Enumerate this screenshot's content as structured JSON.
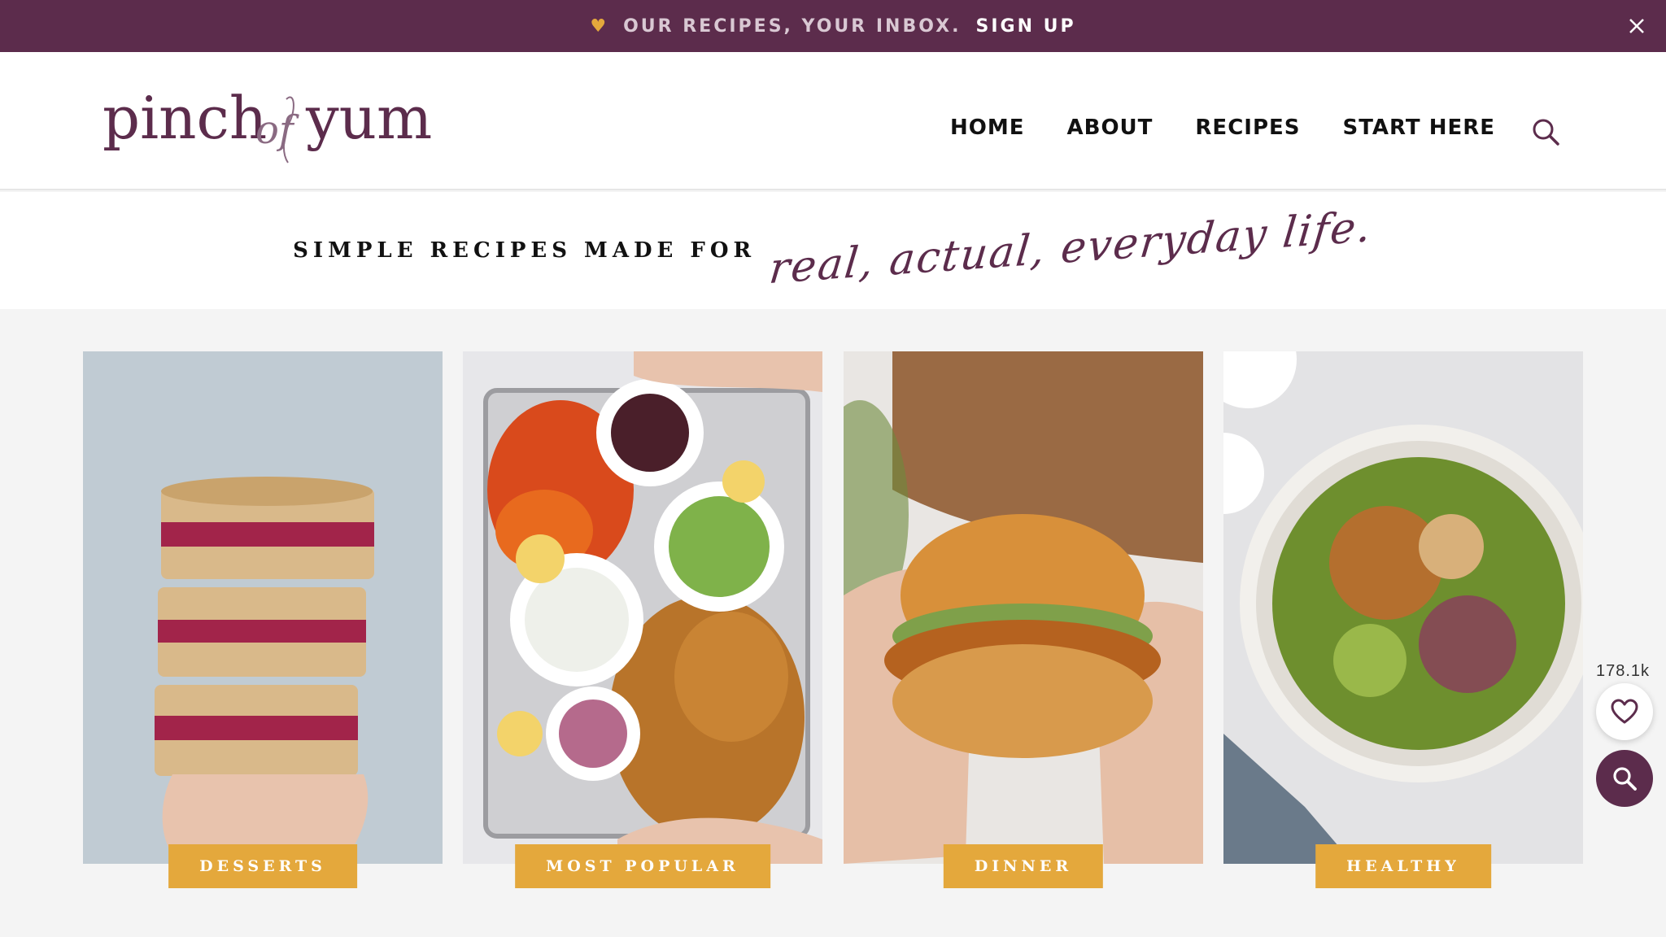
{
  "promo": {
    "text": "OUR RECIPES, YOUR INBOX.",
    "signup_label": "SIGN UP"
  },
  "header": {
    "logo_text": "pinch of yum",
    "nav": [
      "HOME",
      "ABOUT",
      "RECIPES",
      "START HERE"
    ]
  },
  "tagline": {
    "lead": "SIMPLE RECIPES MADE FOR",
    "script": "real, actual, everyday life."
  },
  "categories": [
    "DESSERTS",
    "MOST POPULAR",
    "DINNER",
    "HEALTHY"
  ],
  "favorites": {
    "count": "178.1k"
  },
  "colors": {
    "brand_plum": "#5c2c4c",
    "accent_gold": "#e4a83c"
  },
  "icons": [
    "heart-icon",
    "close-icon",
    "search-icon",
    "favorite-heart-icon"
  ]
}
